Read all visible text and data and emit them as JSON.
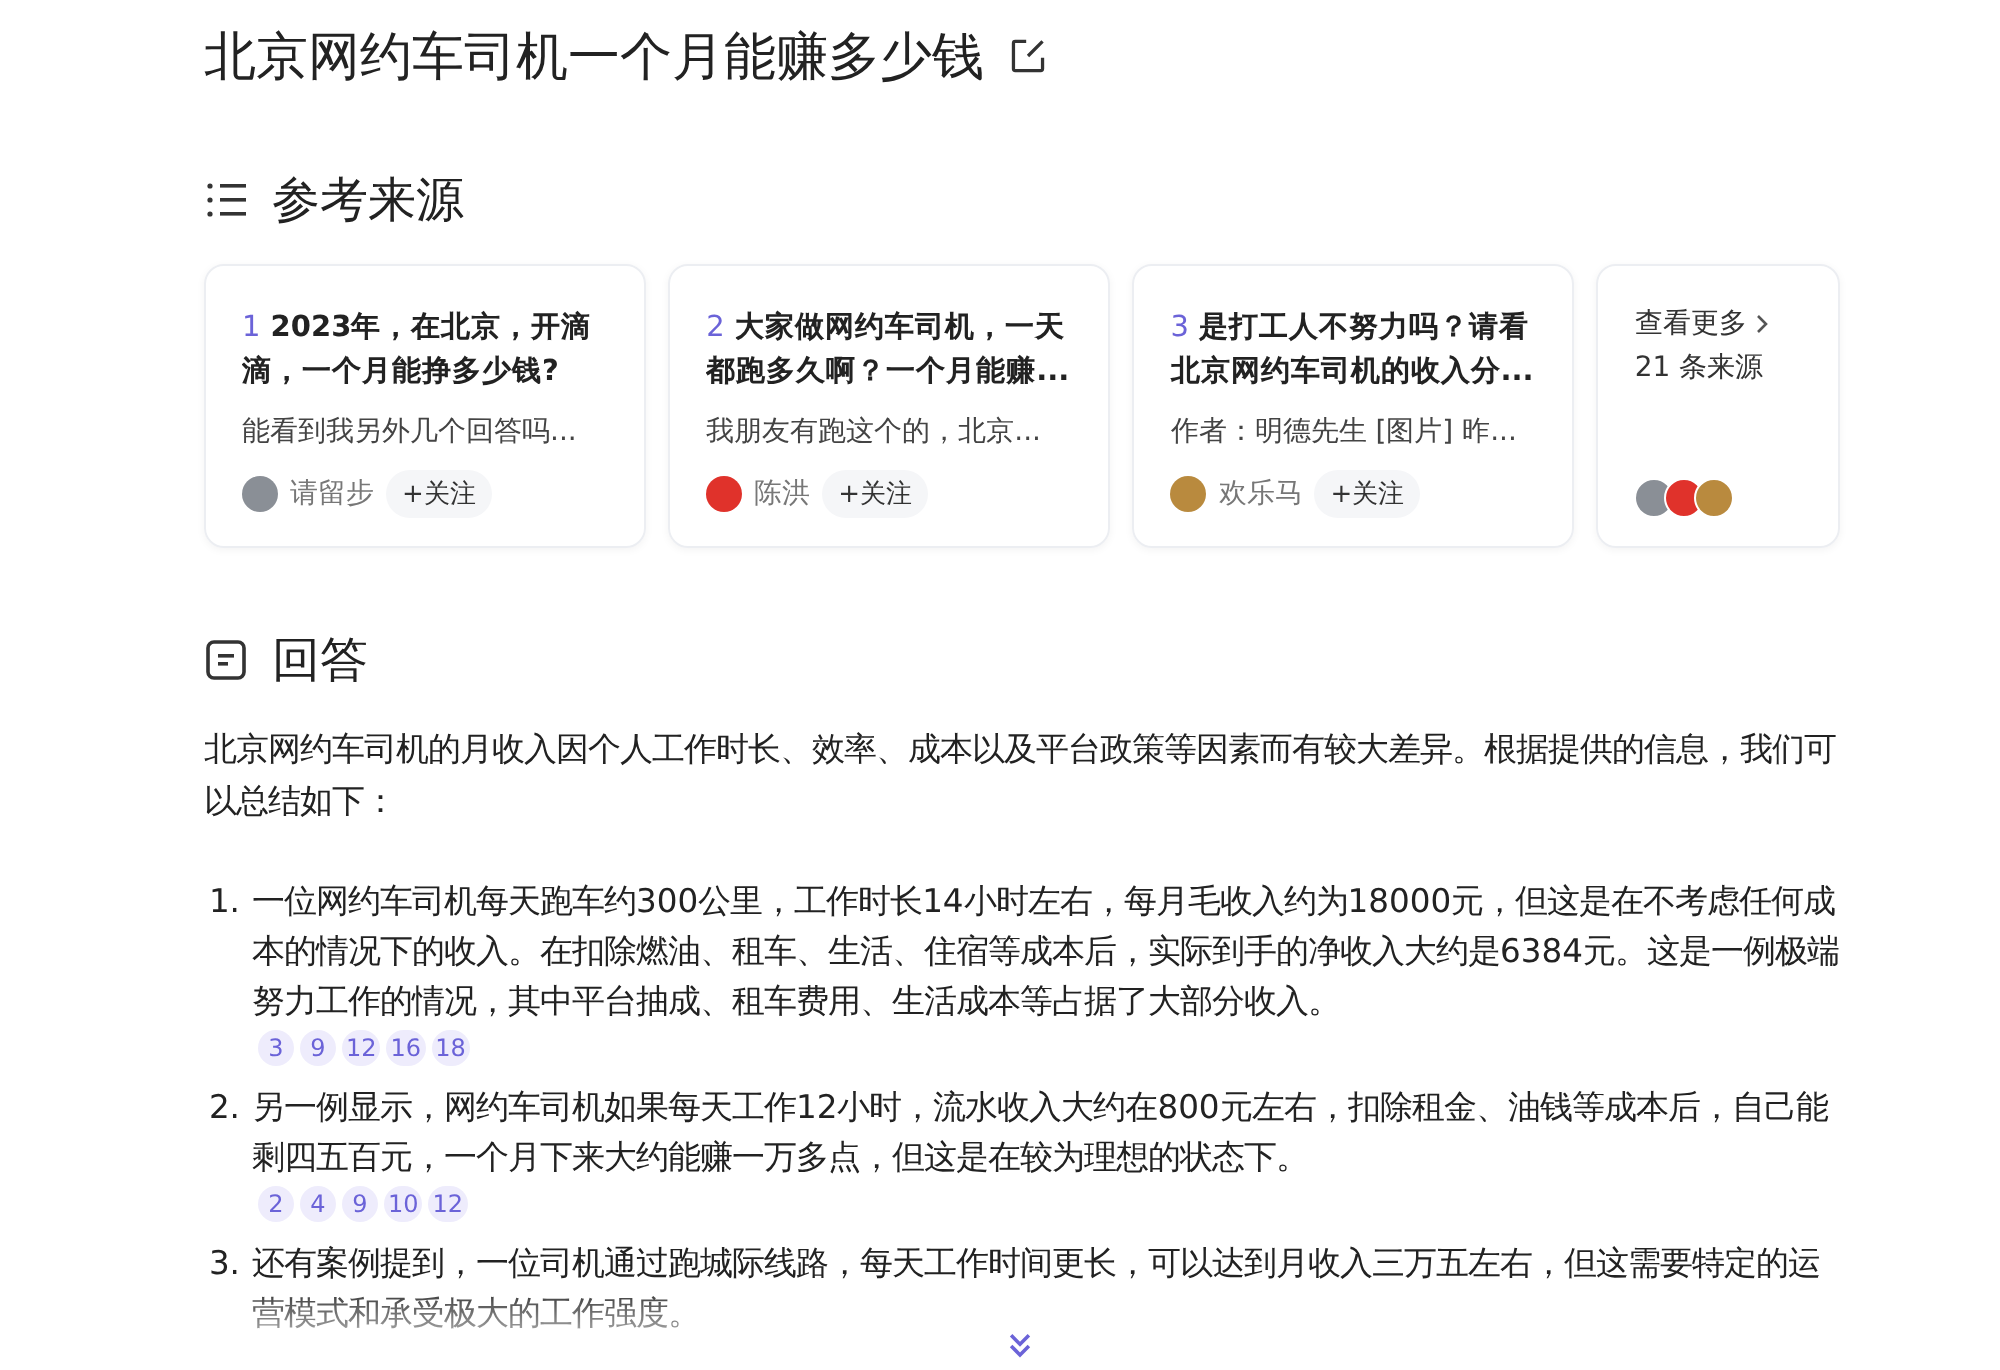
{
  "title": "北京网约车司机一个月能赚多少钱",
  "sources": {
    "heading": "参考来源",
    "cards": [
      {
        "index": "1",
        "title": "2023年，在北京，开滴滴，一个月能挣多少钱?",
        "snippet": "能看到我另外几个回答吗...",
        "author": "请留步",
        "follow": "+关注"
      },
      {
        "index": "2",
        "title": "大家做网约车司机，一天都跑多久啊？一个月能赚...",
        "snippet": "我朋友有跑这个的，北京...",
        "author": "陈洪",
        "follow": "+关注"
      },
      {
        "index": "3",
        "title": "是打工人不努力吗？请看北京网约车司机的收入分...",
        "snippet": "作者：明德先生 [图片] 昨...",
        "author": "欢乐马",
        "follow": "+关注"
      }
    ],
    "more": {
      "label": "查看更多",
      "count": "21 条来源"
    }
  },
  "answer": {
    "heading": "回答",
    "intro": "北京网约车司机的月收入因个人工作时长、效率、成本以及平台政策等因素而有较大差异。根据提供的信息，我们可以总结如下：",
    "items": [
      {
        "number": "1.",
        "text": "一位网约车司机每天跑车约300公里，工作时长14小时左右，每月毛收入约为18000元，但这是在不考虑任何成本的情况下的收入。在扣除燃油、租车、生活、住宿等成本后，实际到手的净收入大约是6384元。这是一例极端努力工作的情况，其中平台抽成、租车费用、生活成本等占据了大部分收入。",
        "citations": [
          "3",
          "9",
          "12",
          "16",
          "18"
        ]
      },
      {
        "number": "2.",
        "text": "另一例显示，网约车司机如果每天工作12小时，流水收入大约在800元左右，扣除租金、油钱等成本后，自己能剩四五百元，一个月下来大约能赚一万多点，但这是在较为理想的状态下。",
        "citations": [
          "2",
          "4",
          "9",
          "10",
          "12"
        ]
      },
      {
        "number": "3.",
        "text": "还有案例提到，一位司机通过跑城际线路，每天工作时间更长，可以达到月收入三万五左右，但这需要特定的运营模式和承受极大的工作强度。"
      }
    ]
  }
}
